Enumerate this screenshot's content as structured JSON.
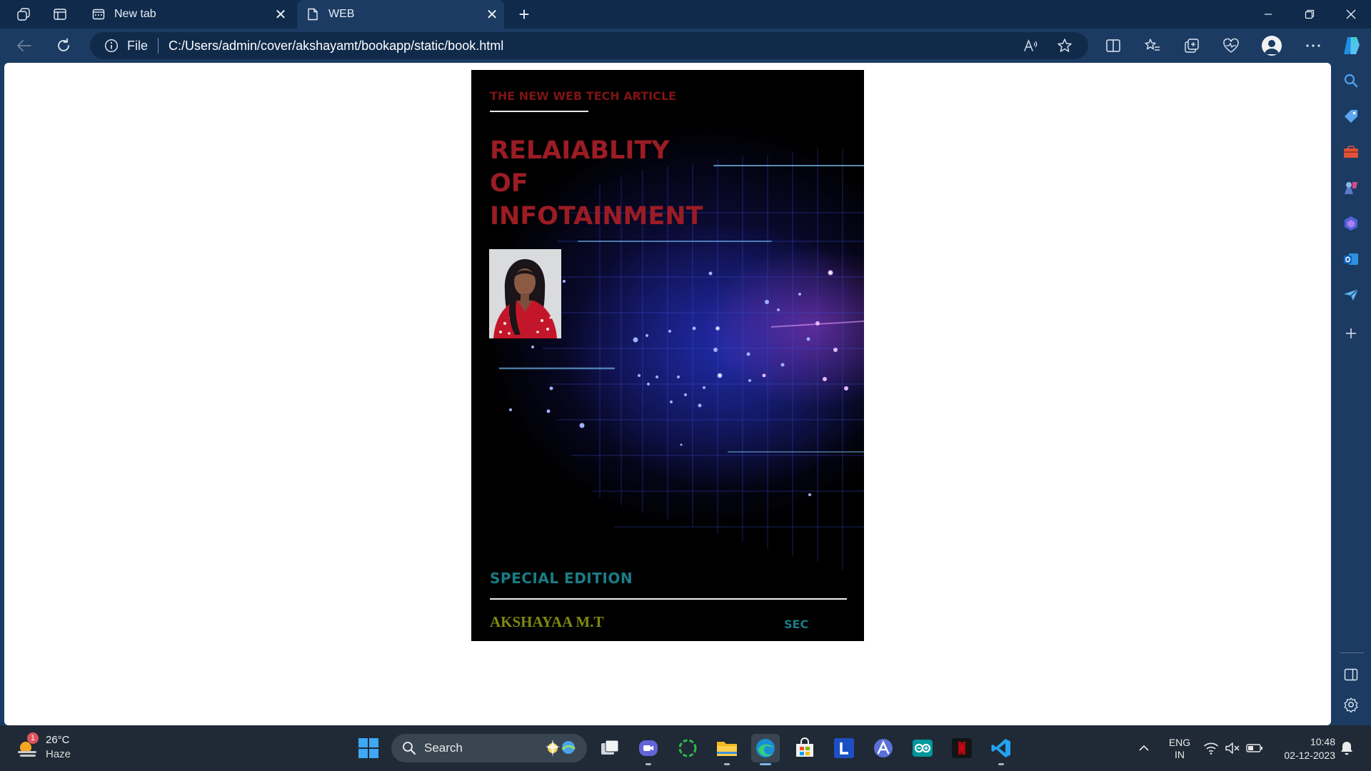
{
  "browser": {
    "tabs": [
      {
        "title": "New tab",
        "icon": "new-tab-page-icon",
        "active": false
      },
      {
        "title": "WEB",
        "icon": "page-icon",
        "active": true
      }
    ],
    "address": {
      "scheme_label": "File",
      "url": "C:/Users/admin/cover/akshayamt/bookapp/static/book.html"
    }
  },
  "cover": {
    "kicker": "THE NEW WEB TECH ARTICLE",
    "headline": [
      "RELAIABLITY",
      "OF",
      "INFOTAINMENT"
    ],
    "edition": "SPECIAL EDITION",
    "author": "AKSHAYAA M.T",
    "publisher": "SEC",
    "colors": {
      "kicker": "#7e1414",
      "headline": "#9b1c24",
      "edition": "#1a7c86",
      "author": "#7f8a10"
    }
  },
  "sidebar": {
    "icons": [
      "search-icon",
      "tag-icon",
      "toolbox-icon",
      "games-icon",
      "copilot-icon",
      "outlook-icon",
      "send-icon",
      "add-icon",
      "split-panel-icon",
      "settings-icon"
    ]
  },
  "taskbar": {
    "weather": {
      "temperature": "26°C",
      "condition": "Haze",
      "badge": "1"
    },
    "search_label": "Search",
    "apps": [
      "start-icon",
      "task-view-icon",
      "meet-icon",
      "refresh-app-icon",
      "file-explorer-icon",
      "edge-icon",
      "store-icon",
      "l-app-icon",
      "arc-app-icon",
      "arduino-icon",
      "netflix-icon",
      "vscode-icon"
    ],
    "language": {
      "line1": "ENG",
      "line2": "IN"
    },
    "clock": {
      "time": "10:48",
      "date": "02-12-2023"
    }
  }
}
